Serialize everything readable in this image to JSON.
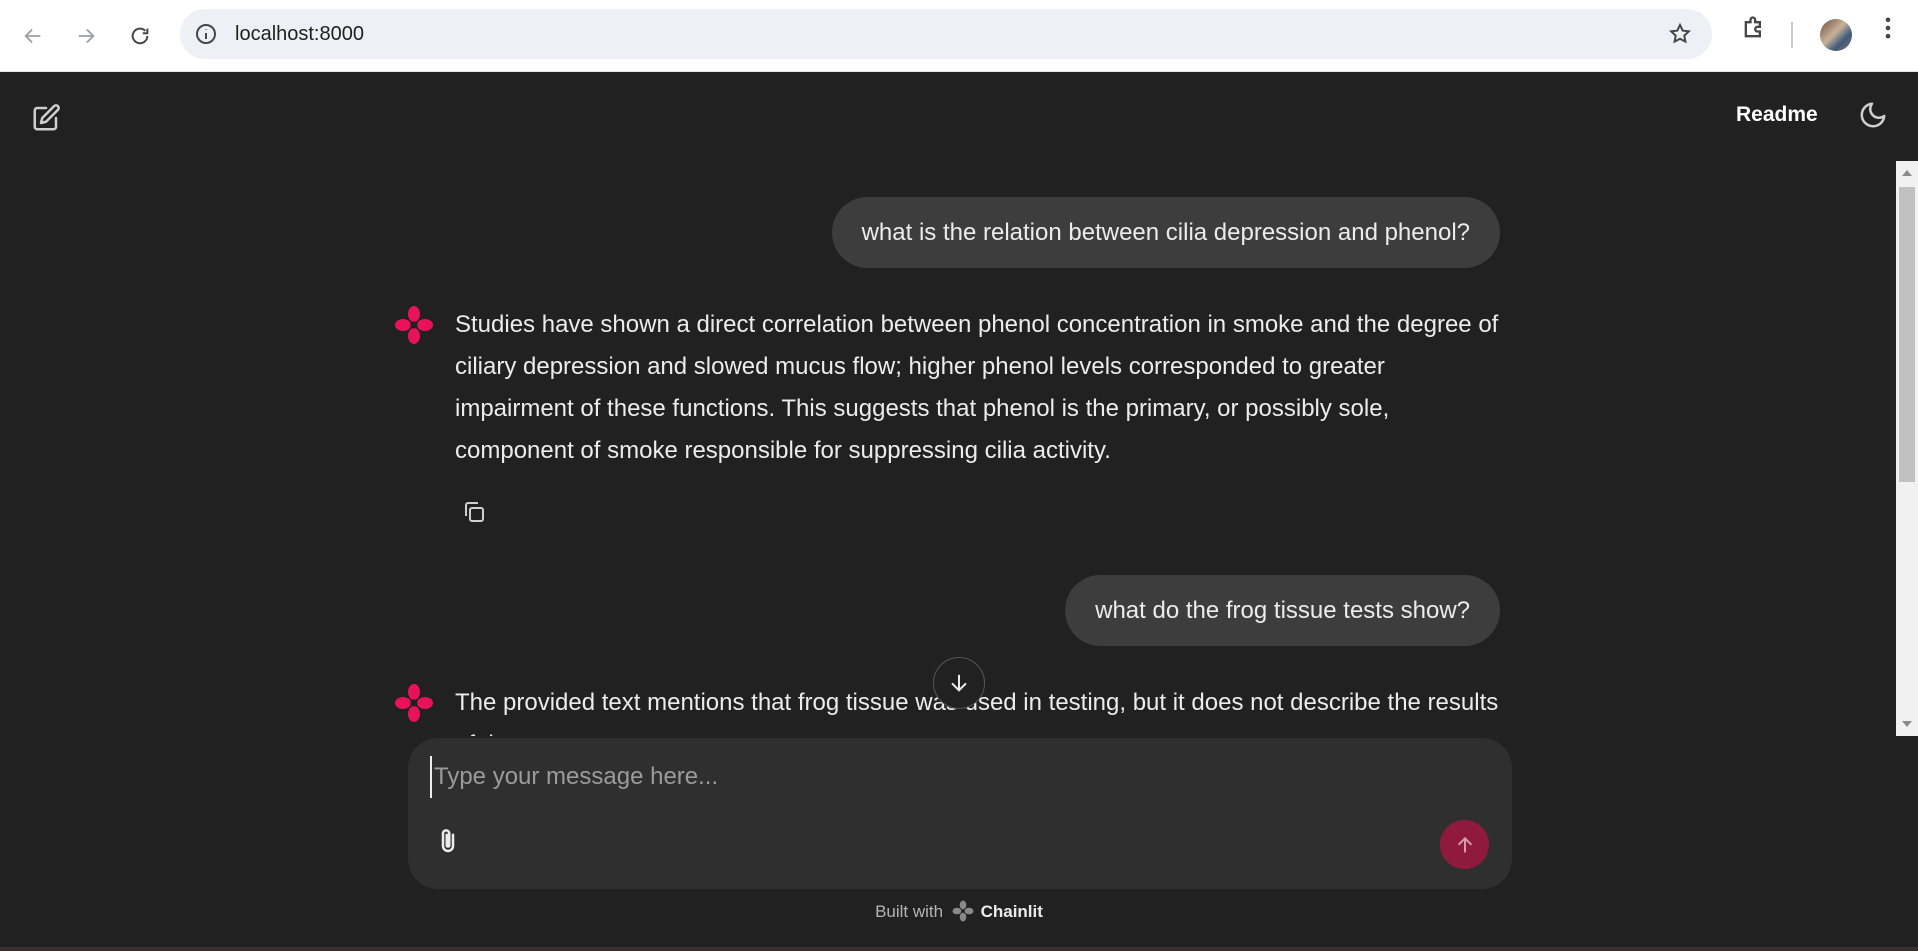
{
  "browser": {
    "url": "localhost:8000"
  },
  "header": {
    "readme_label": "Readme"
  },
  "messages": [
    {
      "role": "user",
      "text": "what is the relation between cilia depression and phenol?"
    },
    {
      "role": "assistant",
      "text": "Studies have shown a direct correlation between phenol concentration in smoke and the degree of ciliary depression and slowed mucus flow; higher phenol levels corresponded to greater impairment of these functions.  This suggests that phenol is the primary, or possibly sole, component of smoke responsible for suppressing cilia activity."
    },
    {
      "role": "user",
      "text": "what do the frog tissue tests show?"
    },
    {
      "role": "assistant",
      "text": "The provided text mentions that frog tissue was used in testing, but it does not describe the results of the tests."
    }
  ],
  "composer": {
    "placeholder": "Type your message here..."
  },
  "footer": {
    "prefix": "Built with",
    "brand": "Chainlit"
  },
  "colors": {
    "background": "#212121",
    "accent": "#e8125a",
    "send_button": "#8f1a3d"
  }
}
